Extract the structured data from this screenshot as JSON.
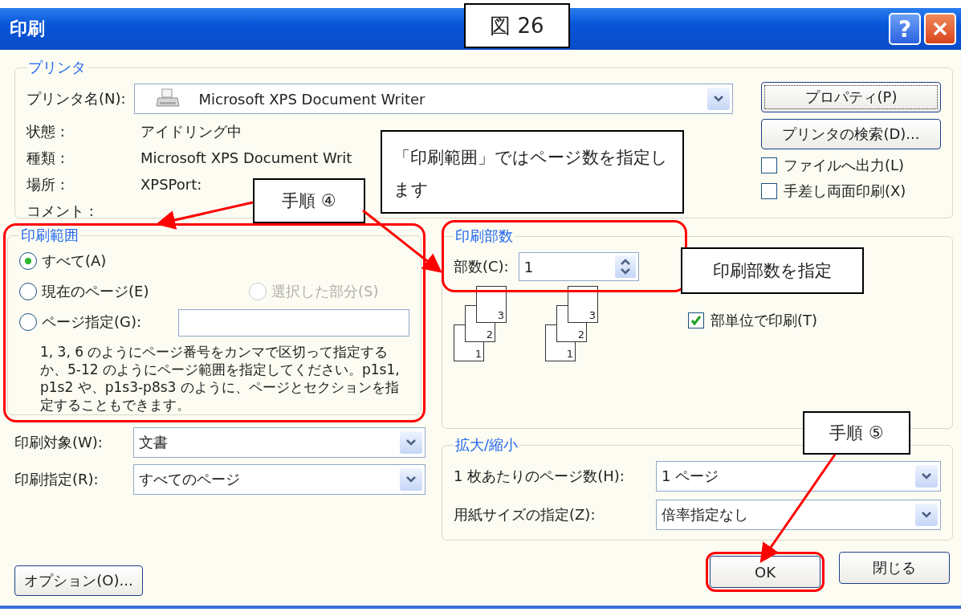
{
  "window": {
    "title": "印刷",
    "help": "?"
  },
  "printer": {
    "title": "プリンタ",
    "name_label": "プリンタ名(N):",
    "name_value": "Microsoft XPS Document Writer",
    "properties_button": "プロパティ(P)",
    "find_button": "プリンタの検索(D)...",
    "info": [
      {
        "label": "状態 :",
        "value": "アイドリング中"
      },
      {
        "label": "種類 :",
        "value": "Microsoft XPS Document Writ"
      },
      {
        "label": "場所 :",
        "value": "XPSPort:"
      },
      {
        "label": "コメント :"
      }
    ],
    "options": [
      {
        "label": "ファイルへ出力(L)",
        "checked": false
      },
      {
        "label": "手差し両面印刷(X)",
        "checked": false
      }
    ]
  },
  "print_range": {
    "title": "印刷範囲",
    "highlighted": true,
    "options": [
      {
        "label": "すべて(A)",
        "selected": true,
        "disabled": false
      },
      {
        "label": "現在のページ(E)",
        "selected": false,
        "disabled": false
      },
      {
        "label": "選択した部分(S)",
        "selected": false,
        "disabled": true
      },
      {
        "label": "ページ指定(G):",
        "selected": false,
        "disabled": false
      }
    ],
    "hint": "1, 3, 6 のようにページ番号をカンマで区切って指定するか、5-12 のようにページ範囲を指定してください。p1s1, p1s2 や、p1s3-p8s3 のように、ページとセクションを指定することもできます。"
  },
  "copies": {
    "title": "印刷部数",
    "highlighted": true,
    "label": "部数(C):",
    "value": "1",
    "collate_icons": [
      {
        "pages": [
          "1",
          "2",
          "3"
        ]
      },
      {
        "pages": [
          "1",
          "2",
          "3"
        ]
      }
    ],
    "collate": {
      "label": "部単位で印刷(T)",
      "checked": true
    }
  },
  "print_what": [
    {
      "label": "印刷対象(W):",
      "value": "文書"
    },
    {
      "label": "印刷指定(R):",
      "value": "すべてのページ"
    }
  ],
  "zoom": {
    "title": "拡大/縮小",
    "rows": [
      {
        "label": "1 枚あたりのページ数(H):",
        "value": "1 ページ"
      },
      {
        "label": "用紙サイズの指定(Z):",
        "value": "倍率指定なし"
      }
    ]
  },
  "buttons": {
    "options": "オプション(O)...",
    "ok": "OK",
    "ok_highlighted": true,
    "close": "閉じる"
  },
  "annotations": {
    "figure_label": "図 26",
    "callouts": [
      {
        "text": "「印刷範囲」ではページ数を指定します"
      },
      {
        "text": "手順 ④"
      },
      {
        "text": "印刷部数を指定"
      },
      {
        "text": "手順 ⑤"
      }
    ]
  }
}
